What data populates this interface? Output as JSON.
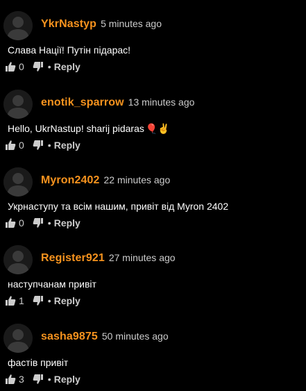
{
  "comments": [
    {
      "username": "YkrNastyp",
      "timestamp": "5 minutes ago",
      "text": "Слава Нації! Путін підарас!",
      "emoji": "",
      "likes": "0",
      "reply_label": "Reply",
      "dot": "•"
    },
    {
      "username": "enotik_sparrow",
      "timestamp": "13 minutes ago",
      "text": "Hello, UkrNastup! sharij pidaras",
      "emoji": "🎈✌",
      "likes": "0",
      "reply_label": "Reply",
      "dot": "•"
    },
    {
      "username": "Myron2402",
      "timestamp": "22 minutes ago",
      "text": "Укрнаступу та всім нашим, привіт від Myron 2402",
      "emoji": "",
      "likes": "0",
      "reply_label": "Reply",
      "dot": "•"
    },
    {
      "username": "Register921",
      "timestamp": "27 minutes ago",
      "text": "наступчанам привіт",
      "emoji": "",
      "likes": "1",
      "reply_label": "Reply",
      "dot": "•"
    },
    {
      "username": "sasha9875",
      "timestamp": "50 minutes ago",
      "text": "фастів привіт",
      "emoji": "",
      "likes": "3",
      "reply_label": "Reply",
      "dot": "•"
    }
  ],
  "colors": {
    "background": "#000000",
    "username": "#f7931e",
    "timestamp": "#cccccc",
    "text": "#ffffff",
    "action": "#cccccc",
    "avatar_bg": "#1a1a1a",
    "avatar_figure": "#3a3a3a"
  },
  "icons": {
    "avatar": "default-user-silhouette",
    "like": "thumbs-up-icon",
    "dislike": "thumbs-down-icon"
  }
}
